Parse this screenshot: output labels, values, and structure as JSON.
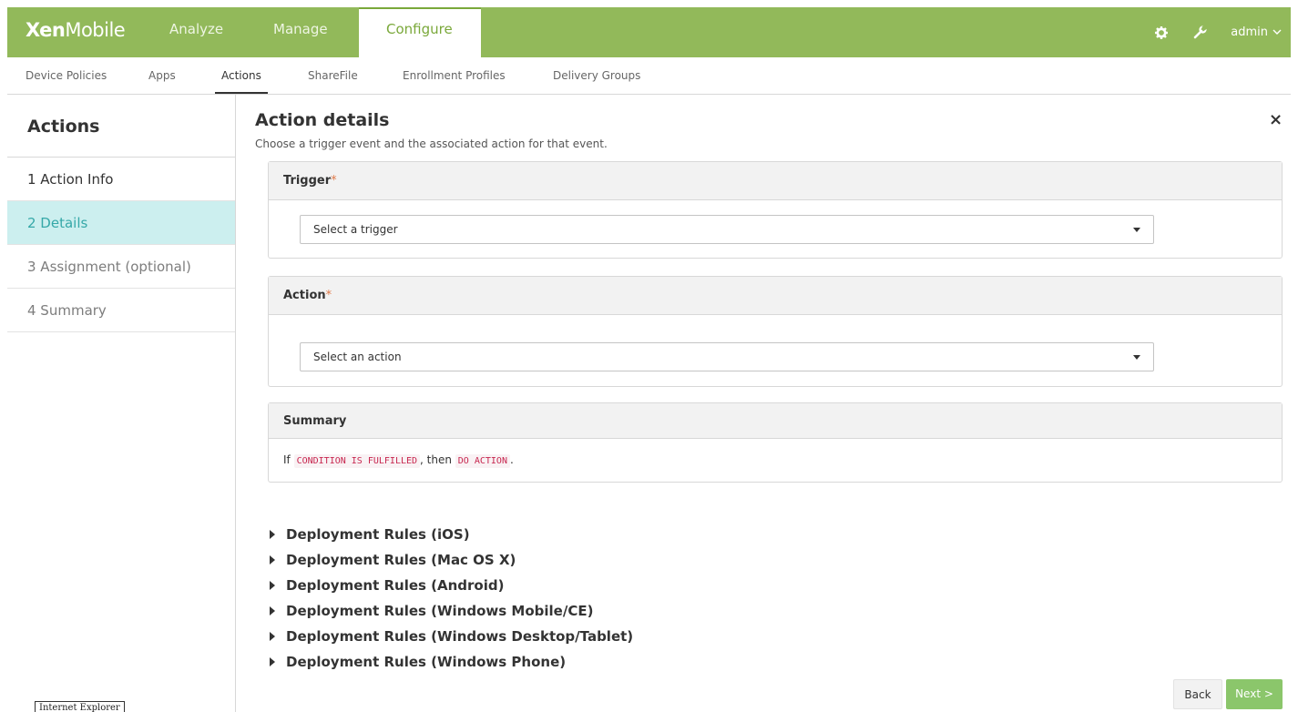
{
  "app": {
    "logo_bold": "Xen",
    "logo_light": "Mobile"
  },
  "topnav": {
    "items": [
      "Analyze",
      "Manage",
      "Configure"
    ],
    "active": "Configure",
    "user": "admin",
    "icons": [
      "gear-icon",
      "wrench-icon",
      "chevron-down-icon"
    ]
  },
  "subnav": {
    "items": [
      "Device Policies",
      "Apps",
      "Actions",
      "ShareFile",
      "Enrollment Profiles",
      "Delivery Groups"
    ],
    "active": "Actions"
  },
  "sidebar": {
    "title": "Actions",
    "steps": [
      "1  Action Info",
      "2  Details",
      "3  Assignment (optional)",
      "4  Summary"
    ],
    "active_step": "2  Details",
    "browser_badge": "Internet Explorer"
  },
  "main": {
    "title": "Action details",
    "subtitle": "Choose a trigger event and the associated action for that event.",
    "close": "×",
    "trigger": {
      "label": "Trigger",
      "required_mark": "*",
      "placeholder": "Select a trigger"
    },
    "action": {
      "label": "Action",
      "required_mark": "*",
      "placeholder": "Select an action"
    },
    "summary": {
      "label": "Summary",
      "text_if": "If ",
      "condition": "CONDITION IS FULFILLED",
      "text_then": ", then ",
      "do_action": "DO ACTION",
      "text_end": "."
    },
    "deployment_rules": [
      "Deployment Rules (iOS)",
      "Deployment Rules (Mac OS X)",
      "Deployment Rules (Android)",
      "Deployment Rules (Windows Mobile/CE)",
      "Deployment Rules (Windows Desktop/Tablet)",
      "Deployment Rules (Windows Phone)"
    ]
  },
  "footer": {
    "back_label": "Back",
    "next_label": "Next >"
  },
  "colors": {
    "topbar": "#92b95a",
    "active_step_bg": "#ccefef",
    "active_step_text": "#35a8a8",
    "next_button": "#8bc66b",
    "required": "#e07a4a",
    "code": "#c7254e"
  }
}
